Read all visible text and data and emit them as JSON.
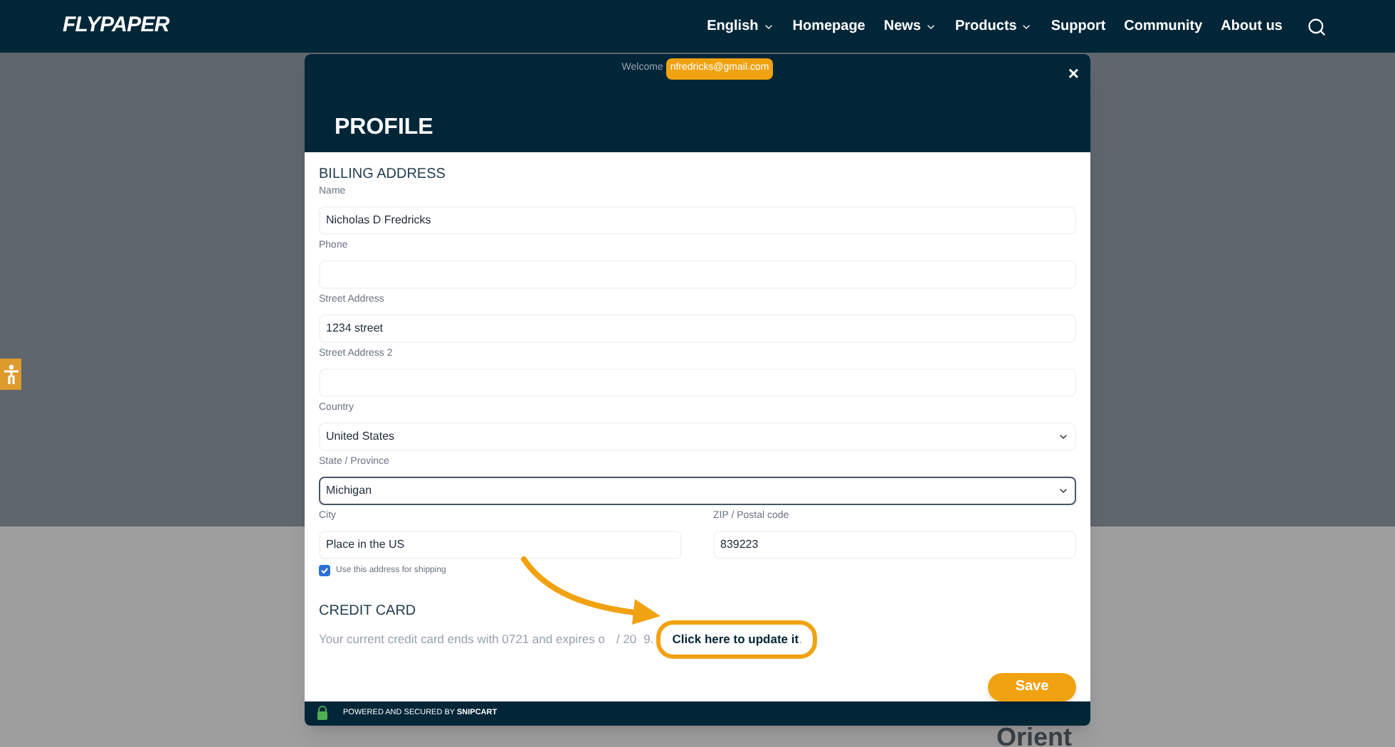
{
  "nav": {
    "logo": "FLYPAPER",
    "items": [
      {
        "label": "English",
        "dropdown": true
      },
      {
        "label": "Homepage",
        "dropdown": false
      },
      {
        "label": "News",
        "dropdown": true
      },
      {
        "label": "Products",
        "dropdown": true
      },
      {
        "label": "Support",
        "dropdown": false
      },
      {
        "label": "Community",
        "dropdown": false
      },
      {
        "label": "About us",
        "dropdown": false
      }
    ]
  },
  "background_text": "Orient",
  "modal": {
    "welcome": "Welcome",
    "email": "nfredricks@gmail.com",
    "close": "×",
    "title": "PROFILE",
    "billing": {
      "heading": "BILLING ADDRESS",
      "fields": [
        {
          "label": "Name",
          "value": "Nicholas D Fredricks",
          "kind": "text",
          "focused": false
        },
        {
          "label": "Phone",
          "kind": "text",
          "focused": false
        },
        {
          "label": "Street Address",
          "value": "1234 street",
          "kind": "text",
          "focused": false
        },
        {
          "label": "Street Address 2",
          "kind": "text",
          "focused": false
        },
        {
          "label": "Country",
          "value": "United States",
          "kind": "select",
          "focused": false
        },
        {
          "label": "State / Province",
          "value": "Michigan",
          "kind": "select",
          "focused": true
        }
      ],
      "row": [
        {
          "label": "City",
          "value": "Place in the US"
        },
        {
          "label": "ZIP / Postal code",
          "value": "839223"
        }
      ],
      "shipping": {
        "label": "Use this address for shipping",
        "checked": true
      }
    },
    "credit": {
      "heading": "CREDIT CARD",
      "text_parts": [
        "Your current credit card ends with 0721 and expires o",
        "/ 20",
        "9."
      ],
      "link": "Click here to update it",
      "after": "."
    },
    "save": "Save",
    "footer": {
      "text": "POWERED AND SECURED BY ",
      "brand": "SNIPCART"
    }
  }
}
